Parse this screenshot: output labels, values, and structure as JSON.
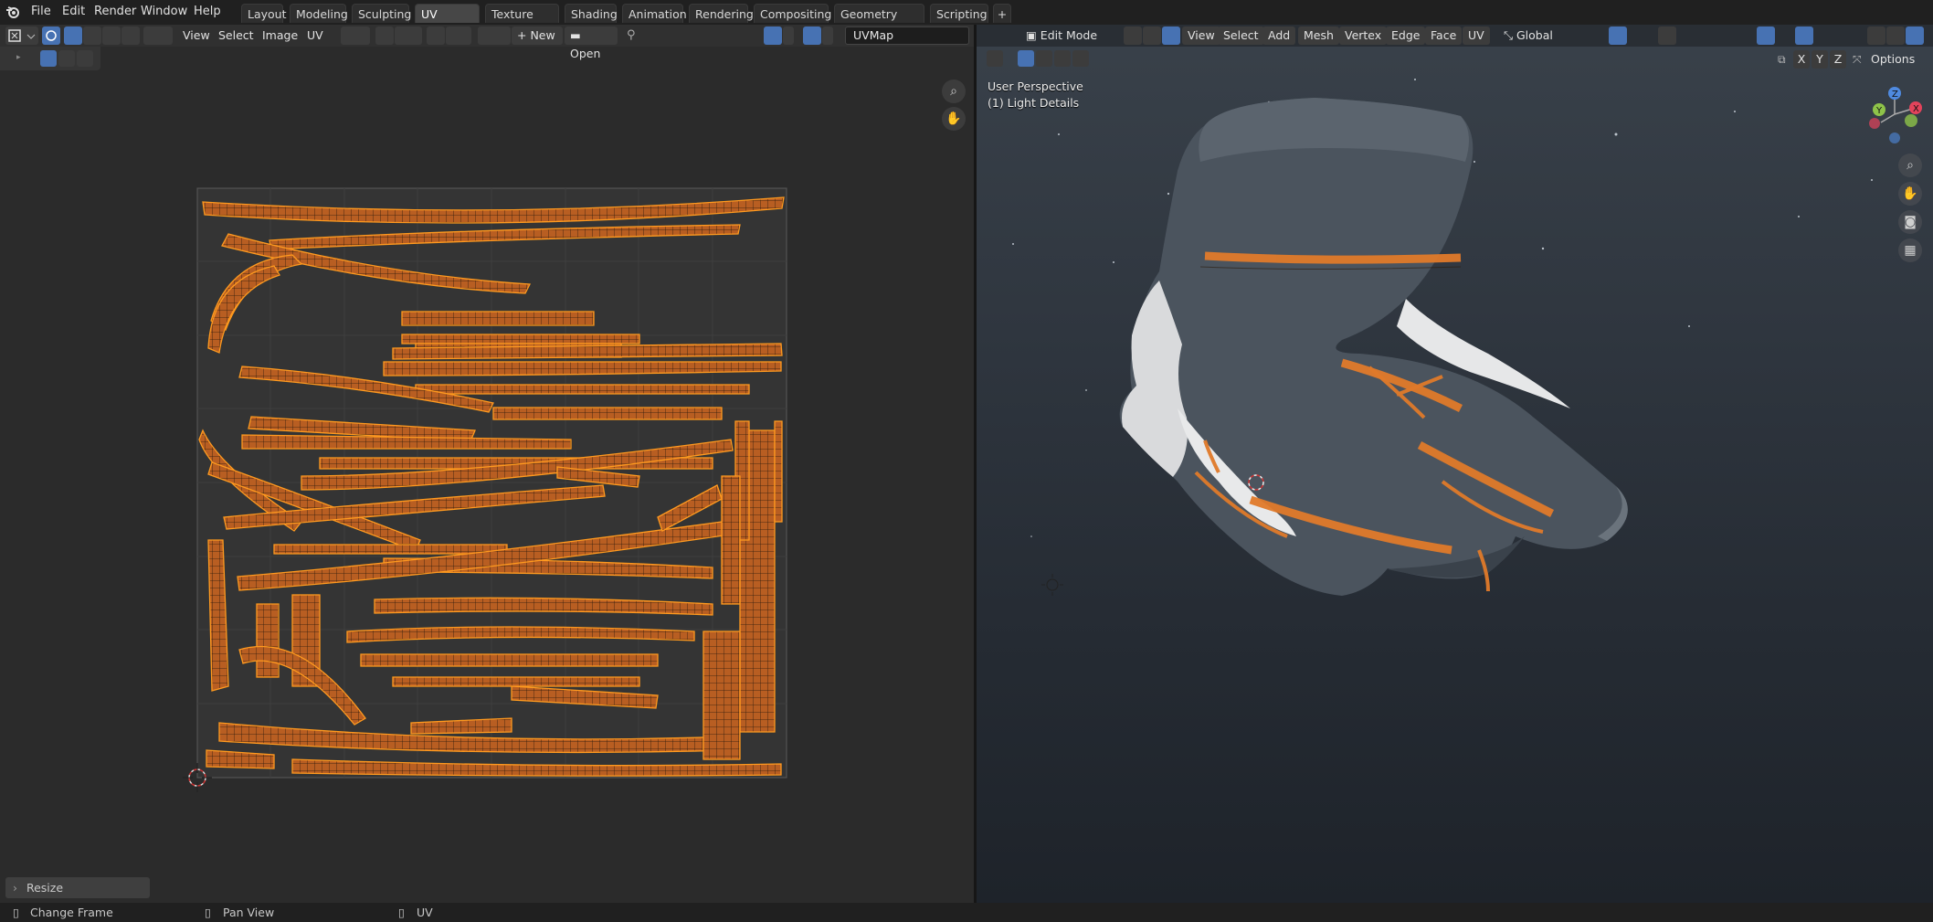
{
  "topbar": {
    "menu": [
      "File",
      "Edit",
      "Render",
      "Window",
      "Help"
    ],
    "workspaces": [
      "Layout",
      "Modeling",
      "Sculpting",
      "UV Editing",
      "Texture Paint",
      "Shading",
      "Animation",
      "Rendering",
      "Compositing",
      "Geometry Nodes",
      "Scripting"
    ],
    "active_workspace": "UV Editing",
    "add_tab": "+"
  },
  "uv_editor": {
    "menus": [
      "View",
      "Select",
      "Image",
      "UV"
    ],
    "new_label": "New",
    "open_label": "Open",
    "uvmap_field": "UVMap",
    "last_operator": "Resize"
  },
  "view3d": {
    "mode": "Edit Mode",
    "menus": [
      "View",
      "Select",
      "Add",
      "Mesh",
      "Vertex",
      "Edge",
      "Face",
      "UV"
    ],
    "orientation": "Global",
    "perspective_label": "User Perspective",
    "object_label": "(1) Light Details",
    "options_label": "Options",
    "axes": [
      "X",
      "Y",
      "Z"
    ],
    "gizmo_axes": {
      "x": "X",
      "y": "Y",
      "z": "Z"
    }
  },
  "statusbar": {
    "items": [
      "Change Frame",
      "Pan View",
      "UV"
    ]
  },
  "colors": {
    "accent": "#4772b3",
    "uv_orange": "#e07a2a",
    "uv_vertex": "#ff9a1f",
    "editor_bg": "#2b2b2b"
  }
}
